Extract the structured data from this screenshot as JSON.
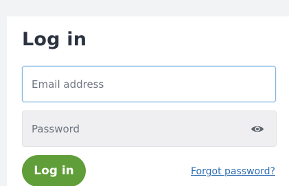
{
  "login_form": {
    "title": "Log in",
    "email": {
      "placeholder": "Email address",
      "value": ""
    },
    "password": {
      "placeholder": "Password",
      "value": "",
      "toggle_icon": "eye-icon"
    },
    "submit_label": "Log in",
    "forgot_password_label": "Forgot password?"
  },
  "colors": {
    "page_background": "#f2f3f5",
    "card_background": "#ffffff",
    "title_text": "#2b3240",
    "email_focus_border": "#7fb3e3",
    "password_background": "#efeff1",
    "primary_button": "#5f9e38",
    "link": "#2f6fb4"
  }
}
